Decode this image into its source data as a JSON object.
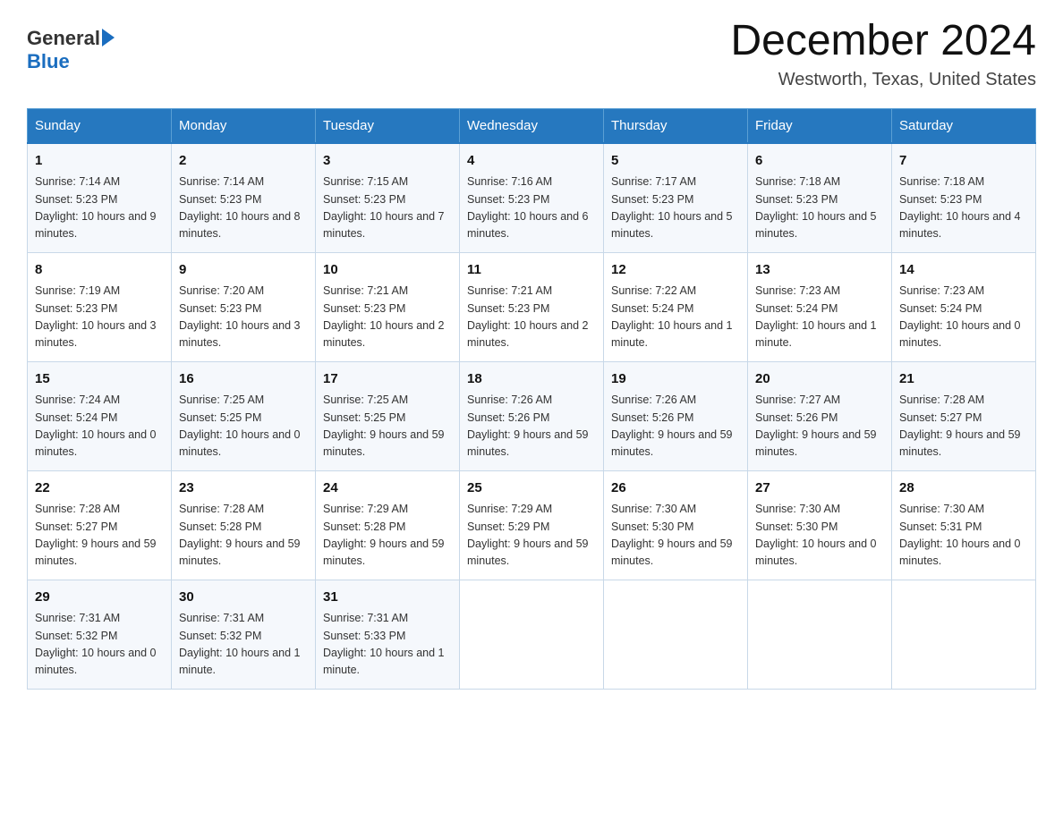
{
  "header": {
    "logo": {
      "general": "General",
      "arrow": "▶",
      "blue": "Blue"
    },
    "title": "December 2024",
    "subtitle": "Westworth, Texas, United States"
  },
  "calendar": {
    "headers": [
      "Sunday",
      "Monday",
      "Tuesday",
      "Wednesday",
      "Thursday",
      "Friday",
      "Saturday"
    ],
    "rows": [
      [
        {
          "day": "1",
          "sunrise": "7:14 AM",
          "sunset": "5:23 PM",
          "daylight": "10 hours and 9 minutes."
        },
        {
          "day": "2",
          "sunrise": "7:14 AM",
          "sunset": "5:23 PM",
          "daylight": "10 hours and 8 minutes."
        },
        {
          "day": "3",
          "sunrise": "7:15 AM",
          "sunset": "5:23 PM",
          "daylight": "10 hours and 7 minutes."
        },
        {
          "day": "4",
          "sunrise": "7:16 AM",
          "sunset": "5:23 PM",
          "daylight": "10 hours and 6 minutes."
        },
        {
          "day": "5",
          "sunrise": "7:17 AM",
          "sunset": "5:23 PM",
          "daylight": "10 hours and 5 minutes."
        },
        {
          "day": "6",
          "sunrise": "7:18 AM",
          "sunset": "5:23 PM",
          "daylight": "10 hours and 5 minutes."
        },
        {
          "day": "7",
          "sunrise": "7:18 AM",
          "sunset": "5:23 PM",
          "daylight": "10 hours and 4 minutes."
        }
      ],
      [
        {
          "day": "8",
          "sunrise": "7:19 AM",
          "sunset": "5:23 PM",
          "daylight": "10 hours and 3 minutes."
        },
        {
          "day": "9",
          "sunrise": "7:20 AM",
          "sunset": "5:23 PM",
          "daylight": "10 hours and 3 minutes."
        },
        {
          "day": "10",
          "sunrise": "7:21 AM",
          "sunset": "5:23 PM",
          "daylight": "10 hours and 2 minutes."
        },
        {
          "day": "11",
          "sunrise": "7:21 AM",
          "sunset": "5:23 PM",
          "daylight": "10 hours and 2 minutes."
        },
        {
          "day": "12",
          "sunrise": "7:22 AM",
          "sunset": "5:24 PM",
          "daylight": "10 hours and 1 minute."
        },
        {
          "day": "13",
          "sunrise": "7:23 AM",
          "sunset": "5:24 PM",
          "daylight": "10 hours and 1 minute."
        },
        {
          "day": "14",
          "sunrise": "7:23 AM",
          "sunset": "5:24 PM",
          "daylight": "10 hours and 0 minutes."
        }
      ],
      [
        {
          "day": "15",
          "sunrise": "7:24 AM",
          "sunset": "5:24 PM",
          "daylight": "10 hours and 0 minutes."
        },
        {
          "day": "16",
          "sunrise": "7:25 AM",
          "sunset": "5:25 PM",
          "daylight": "10 hours and 0 minutes."
        },
        {
          "day": "17",
          "sunrise": "7:25 AM",
          "sunset": "5:25 PM",
          "daylight": "9 hours and 59 minutes."
        },
        {
          "day": "18",
          "sunrise": "7:26 AM",
          "sunset": "5:26 PM",
          "daylight": "9 hours and 59 minutes."
        },
        {
          "day": "19",
          "sunrise": "7:26 AM",
          "sunset": "5:26 PM",
          "daylight": "9 hours and 59 minutes."
        },
        {
          "day": "20",
          "sunrise": "7:27 AM",
          "sunset": "5:26 PM",
          "daylight": "9 hours and 59 minutes."
        },
        {
          "day": "21",
          "sunrise": "7:28 AM",
          "sunset": "5:27 PM",
          "daylight": "9 hours and 59 minutes."
        }
      ],
      [
        {
          "day": "22",
          "sunrise": "7:28 AM",
          "sunset": "5:27 PM",
          "daylight": "9 hours and 59 minutes."
        },
        {
          "day": "23",
          "sunrise": "7:28 AM",
          "sunset": "5:28 PM",
          "daylight": "9 hours and 59 minutes."
        },
        {
          "day": "24",
          "sunrise": "7:29 AM",
          "sunset": "5:28 PM",
          "daylight": "9 hours and 59 minutes."
        },
        {
          "day": "25",
          "sunrise": "7:29 AM",
          "sunset": "5:29 PM",
          "daylight": "9 hours and 59 minutes."
        },
        {
          "day": "26",
          "sunrise": "7:30 AM",
          "sunset": "5:30 PM",
          "daylight": "9 hours and 59 minutes."
        },
        {
          "day": "27",
          "sunrise": "7:30 AM",
          "sunset": "5:30 PM",
          "daylight": "10 hours and 0 minutes."
        },
        {
          "day": "28",
          "sunrise": "7:30 AM",
          "sunset": "5:31 PM",
          "daylight": "10 hours and 0 minutes."
        }
      ],
      [
        {
          "day": "29",
          "sunrise": "7:31 AM",
          "sunset": "5:32 PM",
          "daylight": "10 hours and 0 minutes."
        },
        {
          "day": "30",
          "sunrise": "7:31 AM",
          "sunset": "5:32 PM",
          "daylight": "10 hours and 1 minute."
        },
        {
          "day": "31",
          "sunrise": "7:31 AM",
          "sunset": "5:33 PM",
          "daylight": "10 hours and 1 minute."
        },
        null,
        null,
        null,
        null
      ]
    ],
    "labels": {
      "sunrise": "Sunrise:",
      "sunset": "Sunset:",
      "daylight": "Daylight:"
    }
  }
}
